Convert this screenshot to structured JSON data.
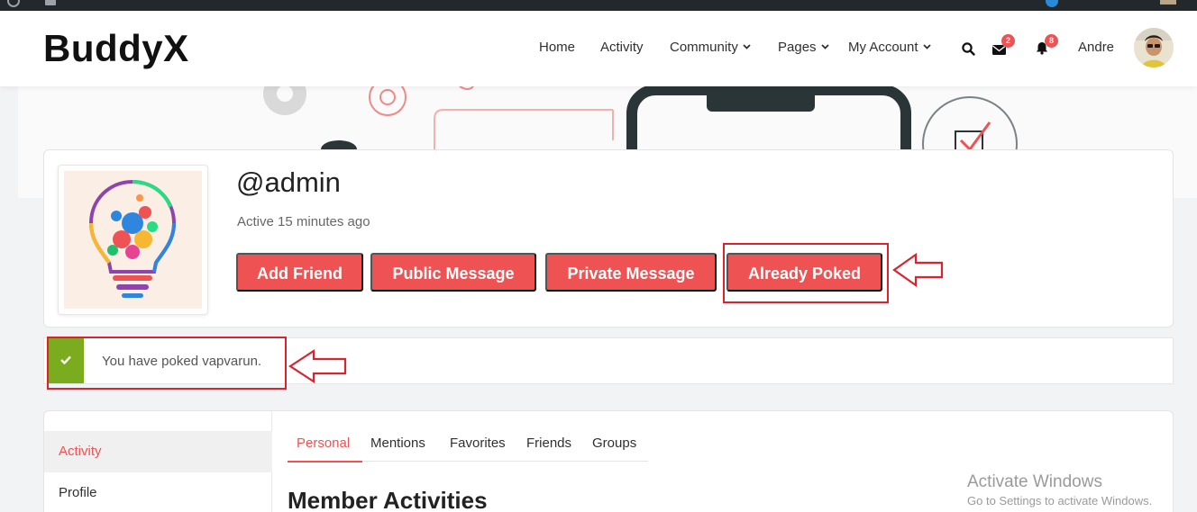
{
  "site": {
    "logo": "BuddyX"
  },
  "nav": {
    "items": [
      {
        "label": "Home"
      },
      {
        "label": "Activity"
      },
      {
        "label": "Community"
      },
      {
        "label": "Pages"
      },
      {
        "label": "My Account"
      }
    ],
    "messages_badge": "2",
    "notifications_badge": "8",
    "user_name": "Andre"
  },
  "profile": {
    "handle": "@admin",
    "last_active": "Active 15 minutes ago",
    "buttons": [
      {
        "label": "Add Friend"
      },
      {
        "label": "Public Message"
      },
      {
        "label": "Private Message"
      },
      {
        "label": "Already Poked"
      }
    ]
  },
  "notice": {
    "message": "You have poked vapvarun."
  },
  "side_nav": {
    "items": [
      {
        "label": "Activity"
      },
      {
        "label": "Profile"
      }
    ]
  },
  "subtabs": {
    "items": [
      {
        "label": "Personal"
      },
      {
        "label": "Mentions"
      },
      {
        "label": "Favorites"
      },
      {
        "label": "Friends"
      },
      {
        "label": "Groups"
      }
    ]
  },
  "section_title": "Member Activities",
  "watermark": {
    "line1": "Activate Windows",
    "line2": "Go to Settings to activate Windows."
  },
  "colors": {
    "accent": "#ee5253",
    "success": "#7bab1f",
    "annotation": "#d9232e"
  }
}
